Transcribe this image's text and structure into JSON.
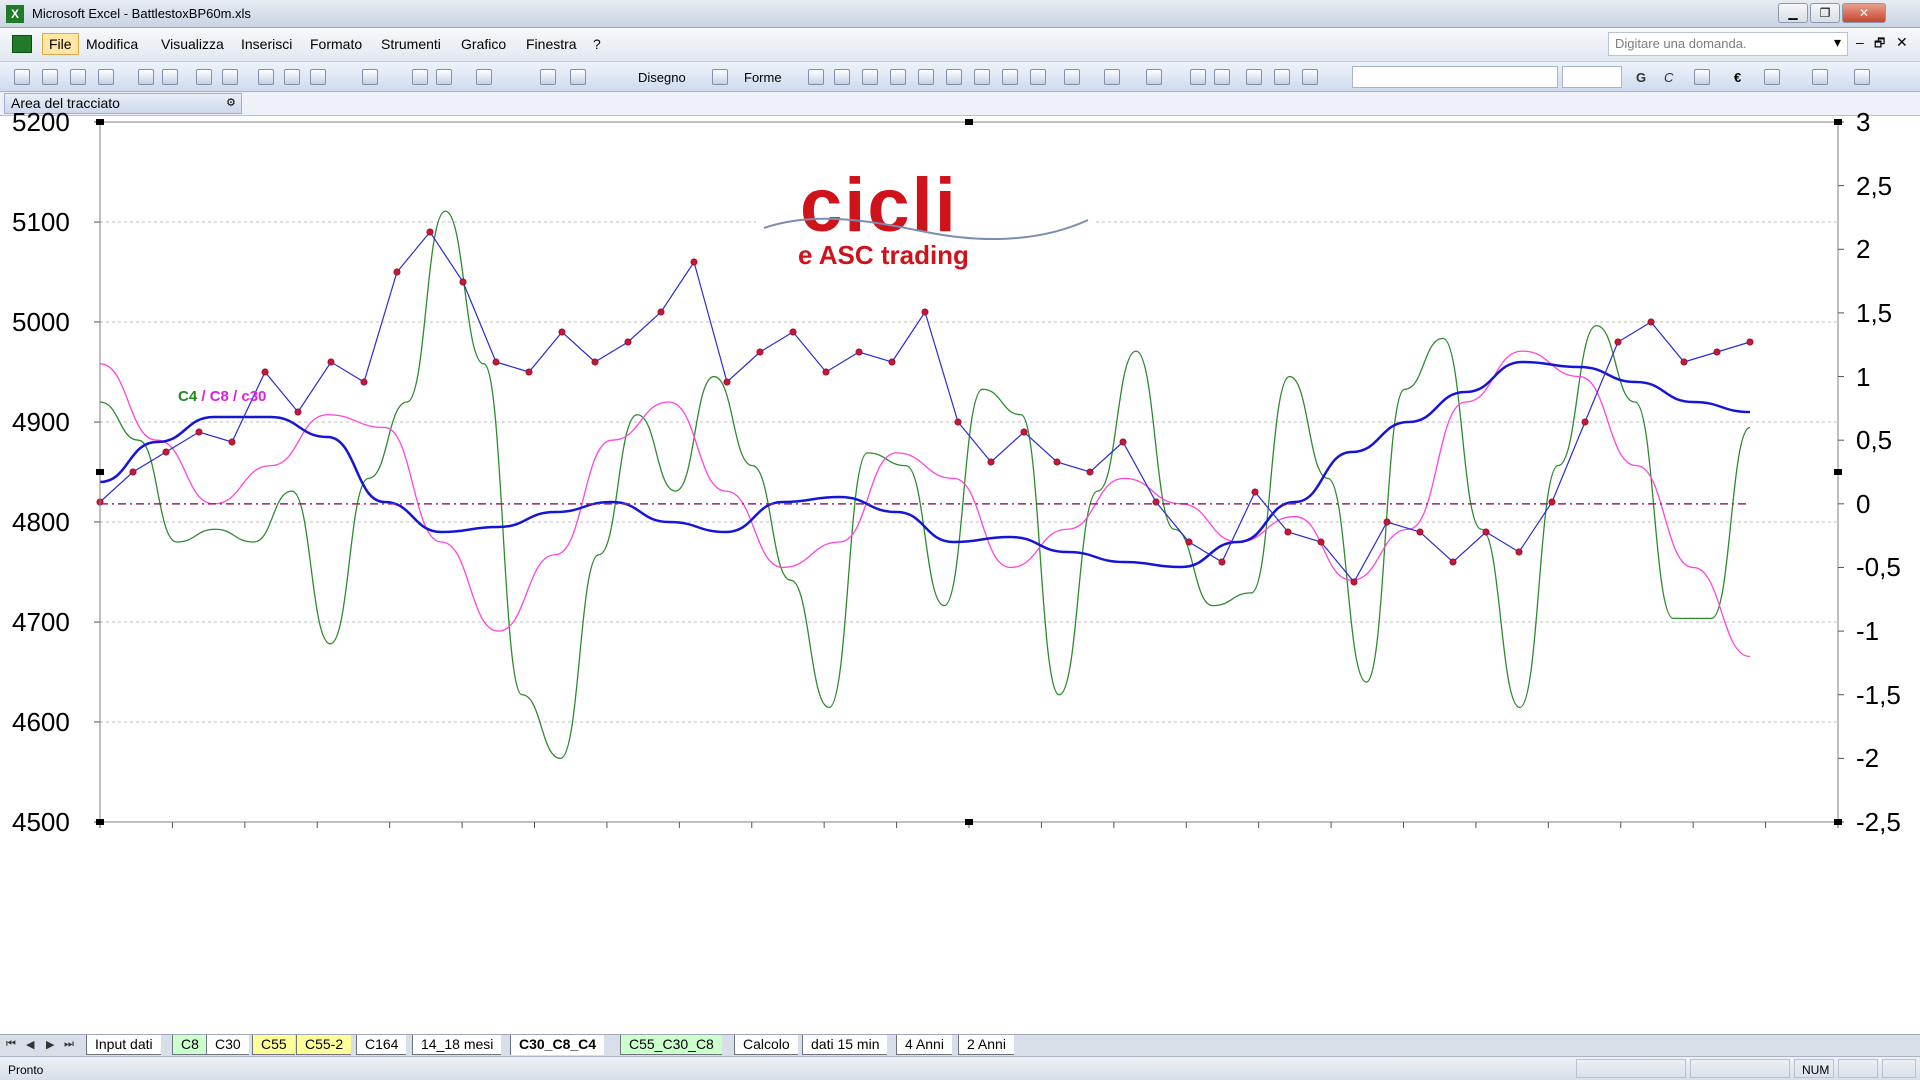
{
  "window": {
    "title": "Microsoft Excel - BattlestoxBP60m.xls",
    "minimize": "▁",
    "maximize": "❐",
    "close": "✕"
  },
  "menubar": {
    "items": [
      "File",
      "Modifica",
      "Visualizza",
      "Inserisci",
      "Formato",
      "Strumenti",
      "Grafico",
      "Finestra",
      "?"
    ],
    "help_placeholder": "Digitare una domanda.",
    "doc_controls": [
      "▾",
      "–",
      "🗗",
      "✕"
    ]
  },
  "toolbar": {
    "draw_label": "Disegno",
    "shapes_label": "Forme",
    "bold": "G",
    "italic": "C",
    "euro": "€"
  },
  "namebar": {
    "name_box": "Area del tracciato"
  },
  "chart": {
    "logo_main": "cicli",
    "logo_sub": "e ASC trading",
    "legend_c4": "C4",
    "legend_rest": " / C8 / c30",
    "left_ticks": [
      "5200",
      "5100",
      "5000",
      "4900",
      "4800",
      "4700",
      "4600",
      "4500"
    ],
    "right_ticks": [
      "3",
      "2,5",
      "2",
      "1,5",
      "1",
      "0,5",
      "0",
      "-0,5",
      "-1",
      "-1,5",
      "-2",
      "-2,5"
    ],
    "colors": {
      "price": "#2b2bd6",
      "price_marker": "#c8163a",
      "c30": "#1515d8",
      "c8": "#ff44dd",
      "c4": "#2e8b2e",
      "zero": "#a0206a"
    }
  },
  "chart_data": {
    "type": "line",
    "ylim_left": [
      4500,
      5200
    ],
    "ylim_right": [
      -2.5,
      3
    ],
    "series": [
      {
        "name": "C4",
        "axis": "right",
        "values": [
          0.8,
          0.5,
          -0.3,
          -0.2,
          -0.3,
          0.1,
          -1.1,
          0.2,
          0.8,
          2.3,
          1.1,
          -1.5,
          -2.0,
          -0.4,
          0.7,
          0.1,
          1.0,
          0.3,
          -0.6,
          -1.6,
          0.4,
          0.3,
          -0.8,
          0.9,
          0.7,
          -1.5,
          0.1,
          1.2,
          -0.2,
          -0.8,
          -0.7,
          1.0,
          0.2,
          -1.4,
          0.9,
          1.3,
          -0.2,
          -1.6,
          0.3,
          1.4,
          0.8,
          -0.9,
          -0.9,
          0.6
        ]
      },
      {
        "name": "C8",
        "axis": "right",
        "values": [
          1.1,
          0.5,
          0.0,
          0.3,
          0.7,
          0.6,
          -0.3,
          -1.0,
          -0.4,
          0.5,
          0.8,
          0.1,
          -0.5,
          -0.3,
          0.4,
          0.2,
          -0.5,
          -0.2,
          0.2,
          0.0,
          -0.3,
          -0.1,
          -0.6,
          -0.2,
          0.8,
          1.2,
          1.0,
          0.3,
          -0.5,
          -1.2
        ]
      },
      {
        "name": "c30",
        "axis": "left",
        "values": [
          4840,
          4880,
          4905,
          4905,
          4885,
          4820,
          4790,
          4795,
          4810,
          4820,
          4800,
          4790,
          4820,
          4825,
          4810,
          4780,
          4785,
          4770,
          4760,
          4755,
          4780,
          4820,
          4870,
          4900,
          4930,
          4960,
          4955,
          4940,
          4920,
          4910
        ]
      },
      {
        "name": "price",
        "axis": "left",
        "values": [
          4820,
          4850,
          4870,
          4890,
          4880,
          4950,
          4910,
          4960,
          4940,
          5050,
          5090,
          5040,
          4960,
          4950,
          4990,
          4960,
          4980,
          5010,
          5060,
          4940,
          4970,
          4990,
          4950,
          4970,
          4960,
          5010,
          4900,
          4860,
          4890,
          4860,
          4850,
          4880,
          4820,
          4780,
          4760,
          4830,
          4790,
          4780,
          4740,
          4800,
          4790,
          4760,
          4790,
          4770,
          4820,
          4900,
          4980,
          5000,
          4960,
          4970,
          4980
        ]
      },
      {
        "name": "zero line",
        "axis": "right",
        "values": [
          0,
          0
        ]
      }
    ]
  },
  "sheet_tabs": {
    "nav": [
      "⏮",
      "◀",
      "▶",
      "⏭"
    ],
    "tabs": [
      "Input dati",
      "C8",
      "C30",
      "C55",
      "C55-2",
      "C164",
      "14_18 mesi",
      "C30_C8_C4",
      "C55_C30_C8",
      "Calcolo",
      "dati 15 min",
      "4 Anni",
      "2 Anni"
    ]
  },
  "status": {
    "text": "Pronto",
    "num": "NUM"
  }
}
